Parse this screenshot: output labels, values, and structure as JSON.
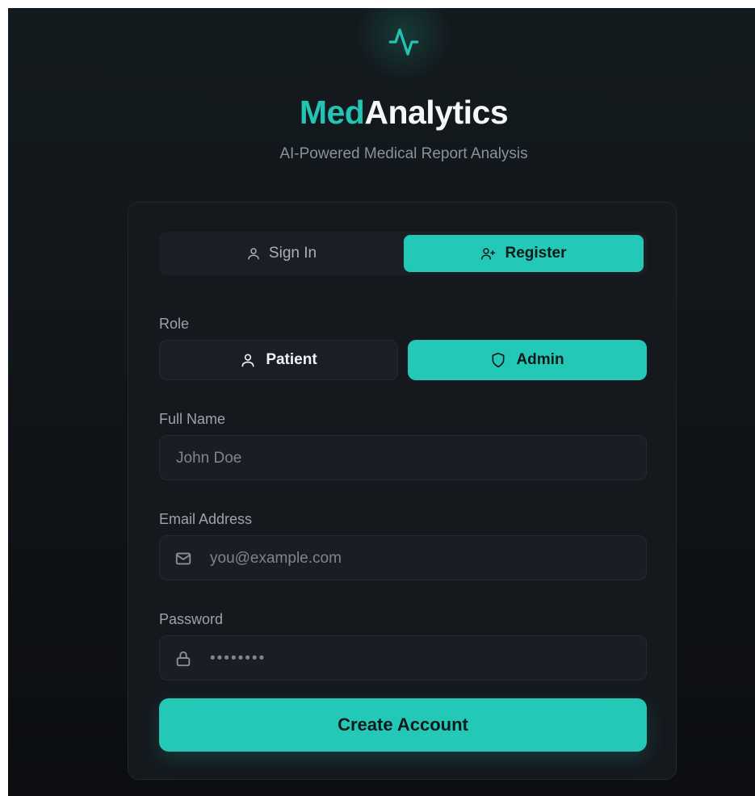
{
  "brand": {
    "name_accent": "Med",
    "name_rest": "Analytics",
    "tagline": "AI-Powered Medical Report Analysis",
    "logo_icon": "activity-pulse-icon"
  },
  "auth_tabs": {
    "sign_in_label": "Sign In",
    "register_label": "Register",
    "active": "Register"
  },
  "role": {
    "label": "Role",
    "patient_label": "Patient",
    "admin_label": "Admin",
    "selected": "Admin"
  },
  "full_name": {
    "label": "Full Name",
    "placeholder": "John Doe",
    "value": ""
  },
  "email": {
    "label": "Email Address",
    "placeholder": "you@example.com",
    "value": ""
  },
  "password": {
    "label": "Password",
    "placeholder": "••••••••",
    "value": ""
  },
  "submit": {
    "label": "Create Account"
  },
  "colors": {
    "accent": "#24c8b6",
    "background": "#12171b",
    "card": "#15191e",
    "input": "#1a1e24",
    "muted_text": "#8a929b"
  }
}
